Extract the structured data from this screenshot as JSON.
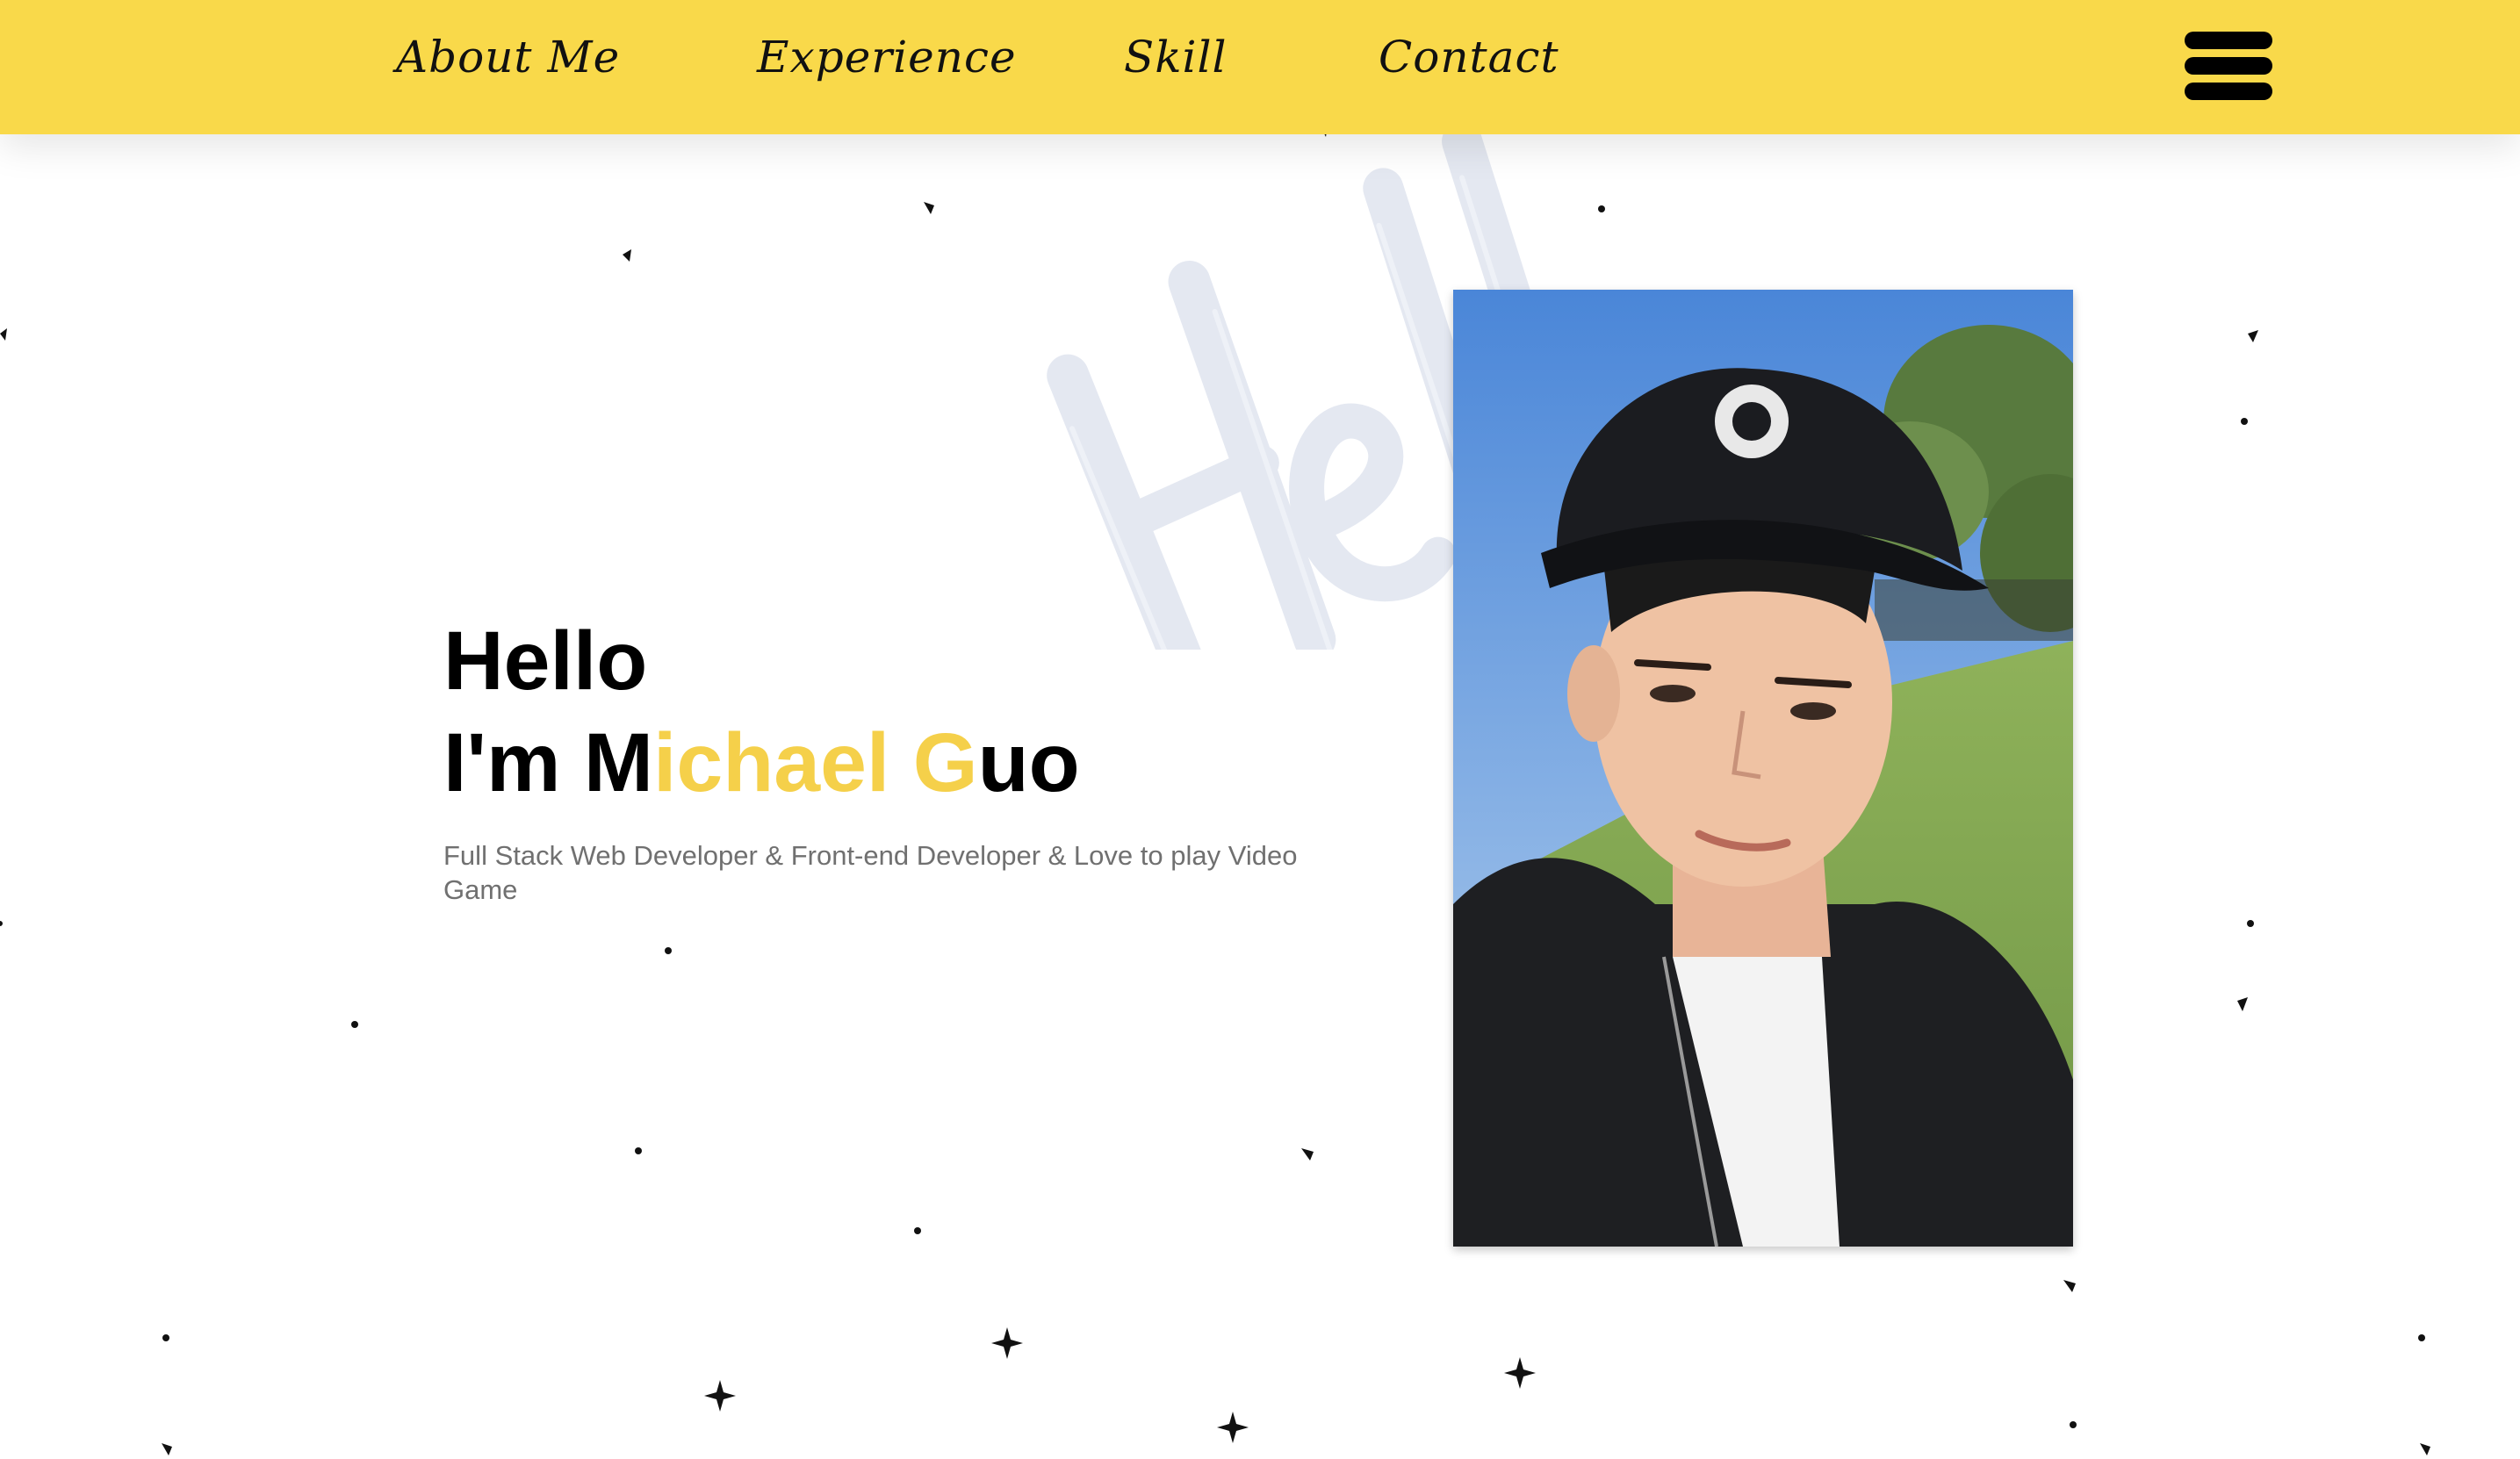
{
  "nav": {
    "items": [
      {
        "label": "About Me"
      },
      {
        "label": "Experience"
      },
      {
        "label": "Skill"
      },
      {
        "label": "Contact"
      }
    ],
    "menu_icon": "hamburger-menu-icon"
  },
  "hero": {
    "watermark_text": "Hello",
    "greeting": "Hello",
    "intro_prefix": "I'm M",
    "name_highlight": "ichael G",
    "name_suffix": "uo",
    "subtitle": "Full Stack Web Developer & Front-end Developer & Love to play Video Game"
  },
  "colors": {
    "accent": "#f9d94a",
    "highlight_text": "#f5d04a",
    "watermark": "#e4e8f1",
    "text": "#000000",
    "subtitle": "#707070"
  }
}
